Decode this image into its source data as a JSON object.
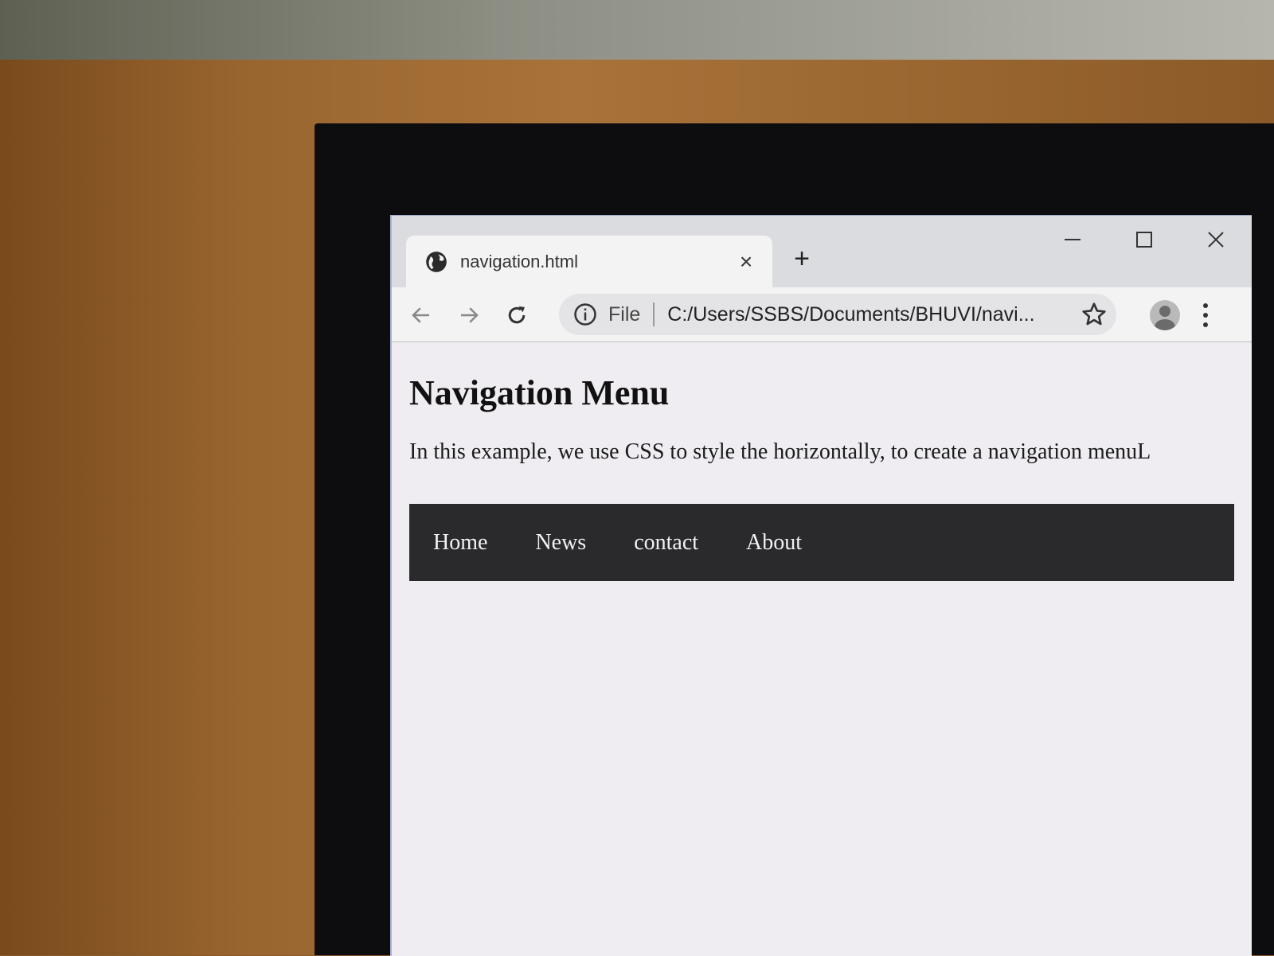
{
  "browser": {
    "tab": {
      "title": "navigation.html",
      "close_glyph": "×",
      "favicon": "globe-icon"
    },
    "new_tab_glyph": "+",
    "window_controls": [
      "minimize-icon",
      "maximize-icon",
      "close-icon"
    ],
    "toolbar": {
      "back_icon": "arrow-left-icon",
      "forward_icon": "arrow-right-icon",
      "reload_icon": "reload-icon"
    },
    "omnibox": {
      "scheme_label": "File",
      "url": "C:/Users/SSBS/Documents/BHUVI/navi...",
      "info_icon": "info-icon",
      "bookmark_icon": "star-icon"
    },
    "profile_icon": "avatar-icon",
    "menu_icon": "kebab-menu-icon"
  },
  "page": {
    "heading": "Navigation Menu",
    "paragraph": "In this example, we use CSS to style the horizontally, to create a navigation menuL",
    "nav_items": [
      "Home",
      "News",
      "contact",
      "About"
    ]
  },
  "colors": {
    "navbar_bg": "#2a2a2c",
    "navbar_text": "#f2f2f2",
    "page_bg": "#efedf2",
    "desk": "#9a6630"
  }
}
